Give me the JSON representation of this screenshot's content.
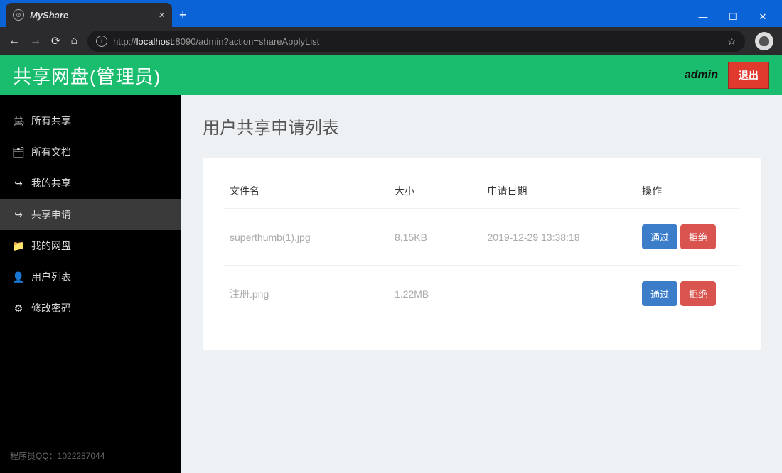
{
  "browser": {
    "tab_title": "MyShare",
    "url_prefix": "http://",
    "url_host": "localhost",
    "url_path": ":8090/admin?action=shareApplyList"
  },
  "header": {
    "app_title": "共享网盘(管理员)",
    "user_label": "admin",
    "logout_label": "退出"
  },
  "sidebar": {
    "items": [
      {
        "icon": "print",
        "label": "所有共享"
      },
      {
        "icon": "files",
        "label": "所有文档"
      },
      {
        "icon": "share",
        "label": "我的共享"
      },
      {
        "icon": "share",
        "label": "共享申请"
      },
      {
        "icon": "folder",
        "label": "我的网盘"
      },
      {
        "icon": "user",
        "label": "用户列表"
      },
      {
        "icon": "gear",
        "label": "修改密码"
      }
    ],
    "active_index": 3,
    "footer": "程序员QQ：1022287044"
  },
  "main": {
    "page_title": "用户共享申请列表",
    "columns": {
      "filename": "文件名",
      "size": "大小",
      "date": "申请日期",
      "ops": "操作"
    },
    "rows": [
      {
        "filename": "superthumb(1).jpg",
        "size": "8.15KB",
        "date": "2019-12-29 13:38:18"
      },
      {
        "filename": "注册.png",
        "size": "1.22MB",
        "date": ""
      }
    ],
    "approve_label": "通过",
    "reject_label": "拒绝"
  }
}
